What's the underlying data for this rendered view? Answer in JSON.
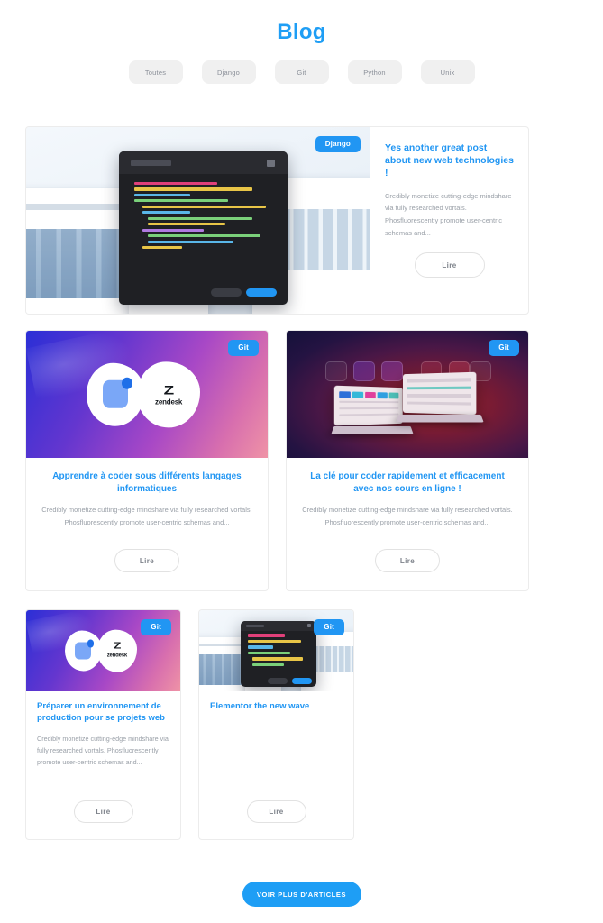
{
  "header": {
    "title": "Blog",
    "filters": [
      {
        "label": "Toutes",
        "name": "filter-toutes"
      },
      {
        "label": "Django",
        "name": "filter-django"
      },
      {
        "label": "Git",
        "name": "filter-git"
      },
      {
        "label": "Python",
        "name": "filter-python"
      },
      {
        "label": "Unix",
        "name": "filter-unix"
      }
    ]
  },
  "excerpt_common": "Credibly monetize cutting-edge mindshare via fully researched vortals. Phosfluorescently promote user-centric schemas and...",
  "read_label": "Lire",
  "featured": {
    "badge": "Django",
    "title": "Yes another great post about new web technologies !",
    "excerpt": "Credibly monetize cutting-edge mindshare via fully researched vortals. Phosfluorescently promote user-centric schemas and...",
    "read_label": "Lire",
    "image": "code-editor-website-mockup-montage"
  },
  "row2": [
    {
      "badge": "Git",
      "title": "Apprendre à coder sous différents langages informatiques",
      "excerpt": "Credibly monetize cutting-edge mindshare via fully researched vortals. Phosfluorescently promote user-centric schemas and...",
      "read_label": "Lire",
      "image": "zendesk-gradient-logo"
    },
    {
      "badge": "Git",
      "title": "La clé pour coder rapidement et efficacement avec nos cours en ligne !",
      "excerpt": "Credibly monetize cutting-edge mindshare via fully researched vortals. Phosfluorescently promote user-centric schemas and...",
      "read_label": "Lire",
      "image": "dark-gradient-laptops"
    }
  ],
  "row3": [
    {
      "badge": "Git",
      "title": "Préparer un environnement de production pour se projets web",
      "excerpt": "Credibly monetize cutting-edge mindshare via fully researched vortals. Phosfluorescently promote user-centric schemas and...",
      "read_label": "Lire",
      "image": "zendesk-gradient-logo"
    },
    {
      "badge": "Git",
      "title": "Elementor the new wave",
      "excerpt": "",
      "read_label": "Lire",
      "image": "code-editor-website-mockup-montage"
    }
  ],
  "footer": {
    "more_label": "VOIR PLUS D'ARTICLES"
  },
  "colors": {
    "accent": "#1e9ef5",
    "badge": "#2196f3",
    "chip_bg": "#f0f0f0",
    "body_text": "#9aa0a8"
  }
}
